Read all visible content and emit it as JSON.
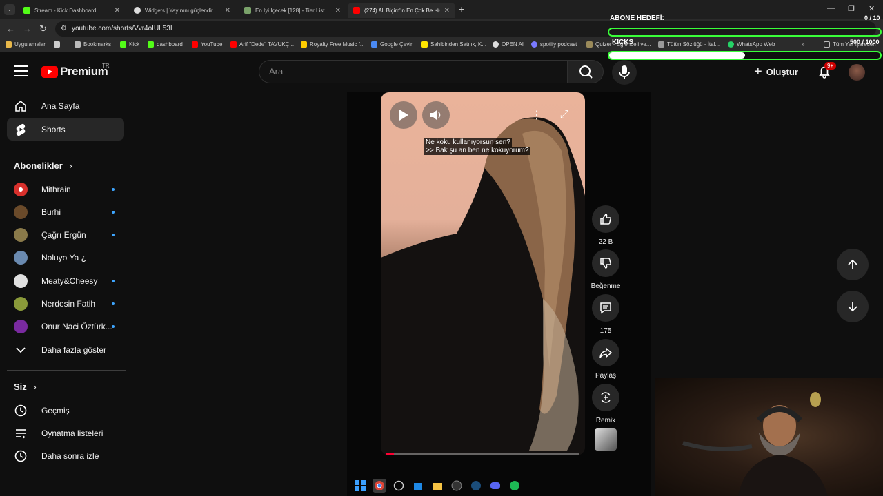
{
  "browser": {
    "tabs": [
      {
        "title": "Stream - Kick Dashboard",
        "favicon_color": "#53fc18"
      },
      {
        "title": "Widgets | Yayınını güçlendirmek",
        "favicon_color": "#dddddd"
      },
      {
        "title": "En İyi İçecek [128] - Tier List, Bl",
        "favicon_color": "#7aa26a"
      },
      {
        "title": "(274) Ali Biçim'in En Çok Be",
        "favicon_color": "#ff0000"
      }
    ],
    "url": "youtube.com/shorts/Vvr4oIUL53I",
    "bookmarks": [
      {
        "label": "Uygulamalar",
        "color": "#e8b84a"
      },
      {
        "label": "",
        "color": "#cccccc"
      },
      {
        "label": "Bookmarks",
        "color": "#bbbbbb"
      },
      {
        "label": "Kick",
        "color": "#53fc18"
      },
      {
        "label": "dashboard",
        "color": "#53fc18"
      },
      {
        "label": "YouTube",
        "color": "#ff0000"
      },
      {
        "label": "Arif \"Dede\" TAVUKÇ...",
        "color": "#ff0000"
      },
      {
        "label": "Royalty Free Music f...",
        "color": "#ffcc00"
      },
      {
        "label": "Google Çeviri",
        "color": "#4a8af4"
      },
      {
        "label": "Sahibinden Satılık, K...",
        "color": "#ffe600"
      },
      {
        "label": "OPEN AI",
        "color": "#dddddd"
      },
      {
        "label": "spotify podcast",
        "color": "#7a7aff"
      },
      {
        "label": "Quizer - Eğlenceli ve...",
        "color": "#9a8a5a"
      },
      {
        "label": "Tütün Sözlüğü - İtal...",
        "color": "#999999"
      },
      {
        "label": "WhatsApp Web",
        "color": "#25d366"
      },
      {
        "label": "Tüm Yer İşaretleri",
        "color": "#bbbbbb"
      }
    ]
  },
  "youtube": {
    "logo_text": "Premium",
    "country_code": "TR",
    "search_placeholder": "Ara",
    "create_label": "Oluştur",
    "notification_badge": "9+"
  },
  "sidebar": {
    "main": [
      {
        "label": "Ana Sayfa",
        "icon": "home-icon"
      },
      {
        "label": "Shorts",
        "icon": "shorts-icon",
        "active": true
      }
    ],
    "subscriptions_title": "Abonelikler",
    "subscriptions": [
      {
        "label": "Mithrain",
        "avatar_color": "#d8302c",
        "new": true
      },
      {
        "label": "Burhi",
        "avatar_color": "#6a4a2a",
        "new": true
      },
      {
        "label": "Çağrı Ergün",
        "avatar_color": "#8a7a4a",
        "new": true
      },
      {
        "label": "Noluyo Ya ¿",
        "avatar_color": "#6a8ab0",
        "new": false
      },
      {
        "label": "Meaty&Cheesy",
        "avatar_color": "#e0e0e0",
        "new": true
      },
      {
        "label": "Nerdesin Fatih",
        "avatar_color": "#8a9a3a",
        "new": true
      },
      {
        "label": "Onur Naci Öztürk...",
        "avatar_color": "#7a2aa0",
        "new": true
      }
    ],
    "show_more_label": "Daha fazla göster",
    "you_title": "Siz",
    "you_items": [
      {
        "label": "Geçmiş",
        "icon": "history-icon"
      },
      {
        "label": "Oynatma listeleri",
        "icon": "playlist-icon"
      },
      {
        "label": "Daha sonra izle",
        "icon": "clock-icon"
      }
    ]
  },
  "short": {
    "caption_line1": "Ne koku kullanıyorsun sen?",
    "caption_line2": ">> Bak şu an ben ne kokuyorum?",
    "progress": 0.04,
    "actions": {
      "like_count": "22 B",
      "dislike_label": "Beğenme",
      "comment_count": "175",
      "share_label": "Paylaş",
      "remix_label": "Remix"
    }
  },
  "overlay": {
    "goal_title": "ABONE HEDEFİ:",
    "goal_count": "0 / 10",
    "goal_progress": 0.0,
    "kicks_title": "KICKS",
    "kicks_count": "500 / 1000",
    "kicks_progress": 0.5,
    "accent_color": "#39ff39"
  }
}
